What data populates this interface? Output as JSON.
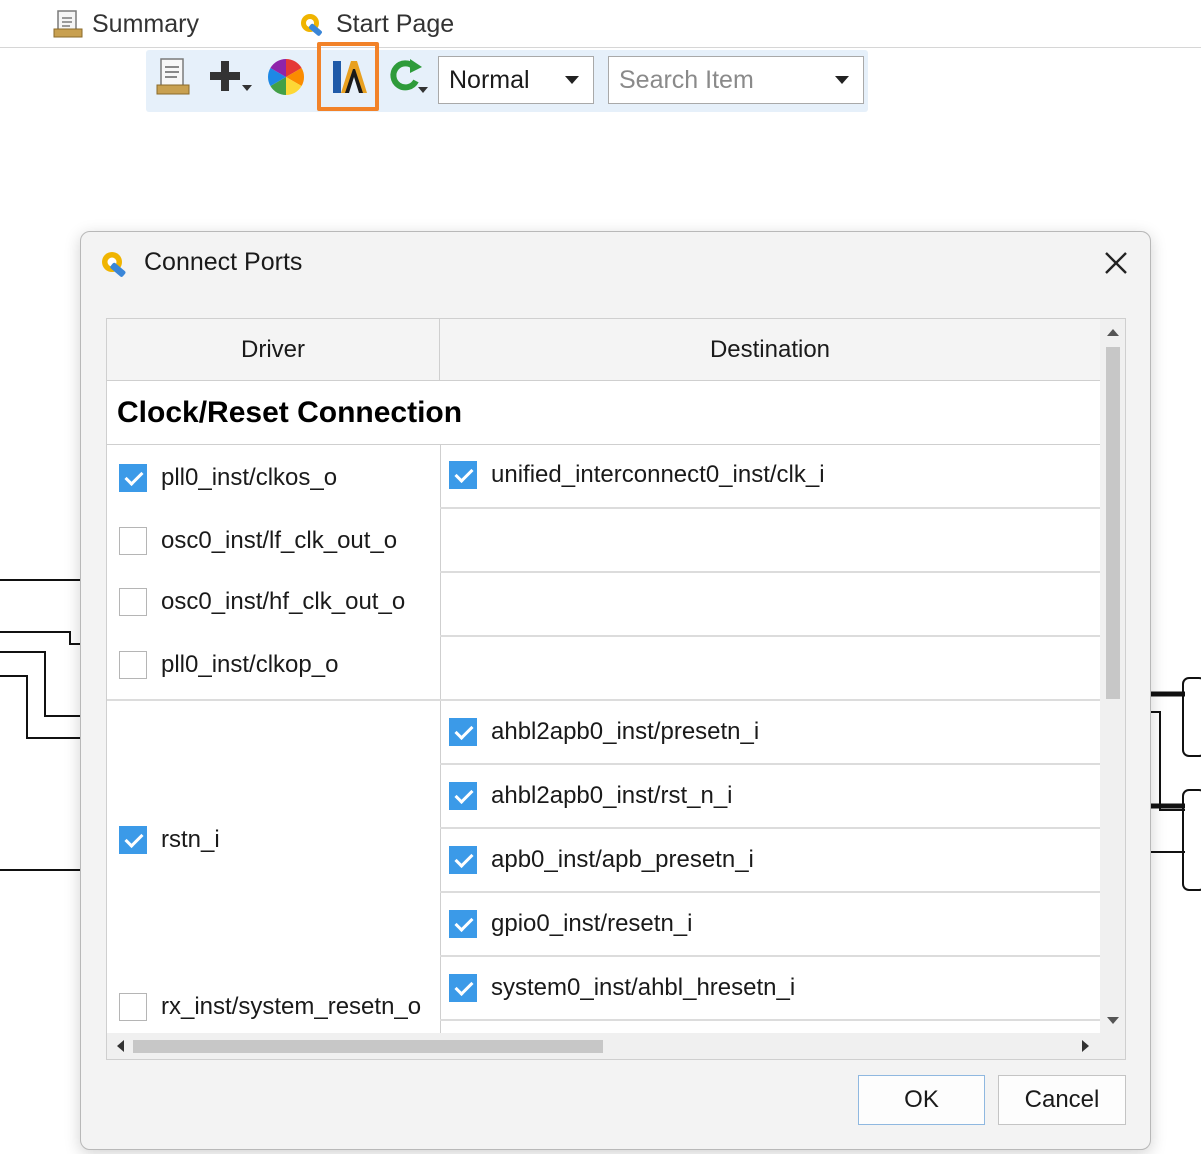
{
  "tabs": [
    {
      "label": "Summary",
      "icon": "document-icon"
    },
    {
      "label": "Start Page",
      "icon": "wrench-gear-icon"
    }
  ],
  "toolbar": {
    "buttons": [
      {
        "icon": "document-icon"
      },
      {
        "icon": "add-plus-icon"
      },
      {
        "icon": "color-wheel-icon"
      },
      {
        "icon": "connect-ports-icon",
        "highlighted": true
      },
      {
        "icon": "refresh-icon"
      }
    ],
    "mode_select": {
      "value": "Normal"
    },
    "search_select": {
      "placeholder": "Search Item"
    },
    "highlight_color": "#f28228"
  },
  "dialog": {
    "title": "Connect Ports",
    "columns": {
      "driver": "Driver",
      "destination": "Destination"
    },
    "section_title": "Clock/Reset Connection",
    "clock_drivers": [
      {
        "label": "pll0_inst/clkos_o",
        "checked": true
      },
      {
        "label": "osc0_inst/lf_clk_out_o",
        "checked": false
      },
      {
        "label": "osc0_inst/hf_clk_out_o",
        "checked": false
      },
      {
        "label": "pll0_inst/clkop_o",
        "checked": false
      }
    ],
    "clock_destinations": [
      {
        "label": "unified_interconnect0_inst/clk_i",
        "checked": true
      }
    ],
    "reset_drivers": [
      {
        "label": "rstn_i",
        "checked": true
      },
      {
        "label": "rx_inst/system_resetn_o",
        "checked": false
      }
    ],
    "reset_destinations": [
      {
        "label": "ahbl2apb0_inst/presetn_i",
        "checked": true
      },
      {
        "label": "ahbl2apb0_inst/rst_n_i",
        "checked": true
      },
      {
        "label": "apb0_inst/apb_presetn_i",
        "checked": true
      },
      {
        "label": "gpio0_inst/resetn_i",
        "checked": true
      },
      {
        "label": "system0_inst/ahbl_hresetn_i",
        "checked": true
      }
    ],
    "buttons": {
      "ok": "OK",
      "cancel": "Cancel"
    },
    "accent": "#3b9ae8"
  }
}
